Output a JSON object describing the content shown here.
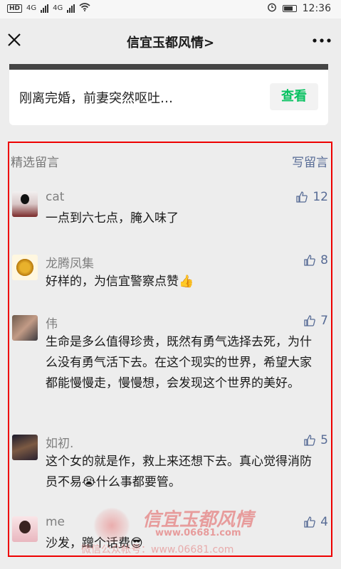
{
  "status_bar": {
    "network_badge": "HD",
    "signal_1": "4G",
    "signal_2": "4G",
    "time": "12:36"
  },
  "nav": {
    "title": "信宜玉都风情",
    "title_chevron": ">"
  },
  "article_card": {
    "text": "刚离完婚，前妻突然呕吐…",
    "button_label": "查看"
  },
  "comments_section": {
    "title": "精选留言",
    "write_label": "写留言",
    "items": [
      {
        "nickname": "cat",
        "text": "一点到六七点，腌入味了 ",
        "likes": "12",
        "avatar": "cat-avatar"
      },
      {
        "nickname": "龙腾凤集",
        "text": "好样的，为信宜警察点赞👍",
        "likes": "8",
        "avatar": "dragon-avatar"
      },
      {
        "nickname": "伟",
        "text": "生命是多么值得珍贵，既然有勇气选择去死，为什么没有勇气活下去。在这个现实的世界，希望大家都能慢慢走，慢慢想，会发现这个世界的美好。",
        "likes": "7",
        "avatar": "photo-avatar"
      },
      {
        "nickname": "如初.",
        "text": "这个女的就是作，救上来还想下去。真心觉得消防员不易😭什么事都要管。",
        "likes": "5",
        "avatar": "photo-avatar"
      },
      {
        "nickname": "me",
        "text": "沙发，蹭个话费😎",
        "likes": "4",
        "avatar": "girl-avatar"
      }
    ]
  },
  "watermark": {
    "title": "信宜玉都风情",
    "url": "www.06681.com",
    "sub": "微信公众帐号：www.06681.com"
  },
  "colors": {
    "link_blue": "#576b95",
    "wechat_green": "#07c160",
    "highlight_red": "#e00000"
  }
}
